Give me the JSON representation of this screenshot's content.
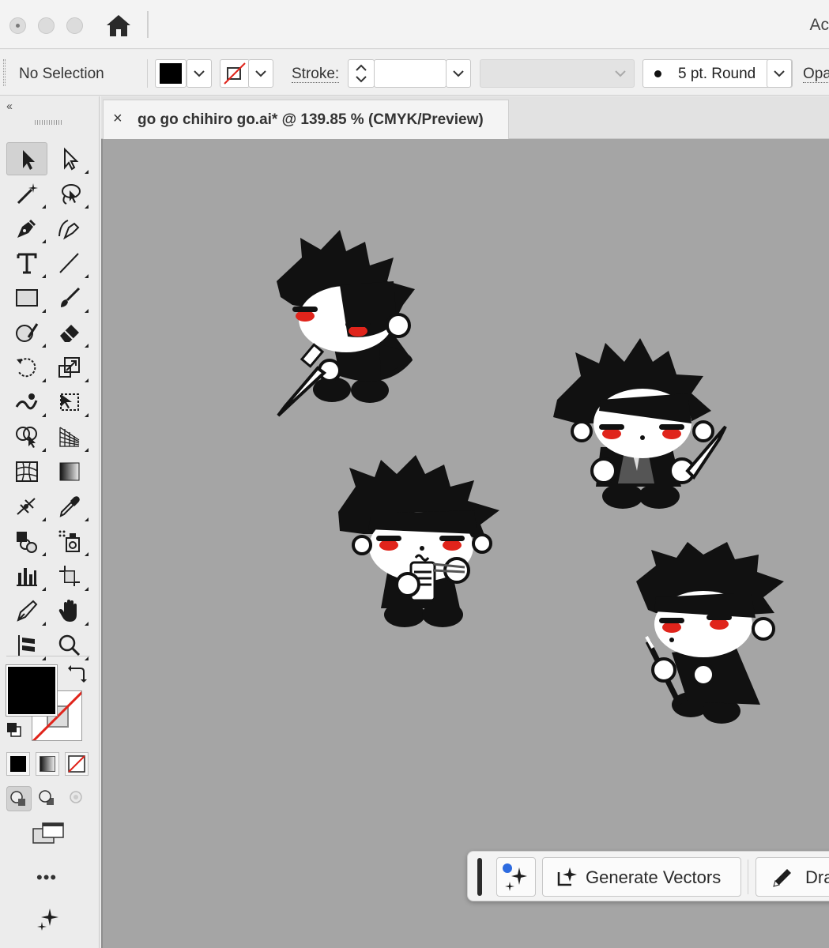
{
  "window": {
    "app_title": "Ac"
  },
  "control_bar": {
    "selection_label": "No Selection",
    "stroke_label": "Stroke:",
    "brush_label": "5 pt. Round",
    "opacity_label": "Opa"
  },
  "document_tab": {
    "close_glyph": "×",
    "title": "go go chihiro go.ai* @ 139.85 % (CMYK/Preview)"
  },
  "toolbar": {
    "collapse_glyph": "‹‹",
    "more_glyph": "•••",
    "tools": [
      "selection-tool",
      "direct-selection-tool",
      "magic-wand-tool",
      "lasso-tool",
      "pen-tool",
      "curvature-tool",
      "type-tool",
      "line-segment-tool",
      "rectangle-tool",
      "paintbrush-tool",
      "shaper-tool",
      "eraser-tool",
      "rotate-tool",
      "scale-tool",
      "warp-tool",
      "free-transform-tool",
      "shape-builder-tool",
      "perspective-grid-tool",
      "mesh-tool",
      "gradient-tool",
      "blend-tool",
      "eyedropper-tool",
      "symbol-sprayer-tool",
      "live-paint-bucket-tool",
      "column-graph-tool",
      "artboard-tool",
      "slice-tool",
      "hand-tool",
      "puppet-warp-tool",
      "zoom-tool"
    ],
    "fill_color": "#000000",
    "stroke_color": "none"
  },
  "context_bar": {
    "generate_label": "Generate Vectors",
    "draw_label": "Draw"
  },
  "colors": {
    "canvas": "#a5a5a5",
    "accent_red": "#e0241b",
    "ai_blue": "#2d6be0"
  }
}
